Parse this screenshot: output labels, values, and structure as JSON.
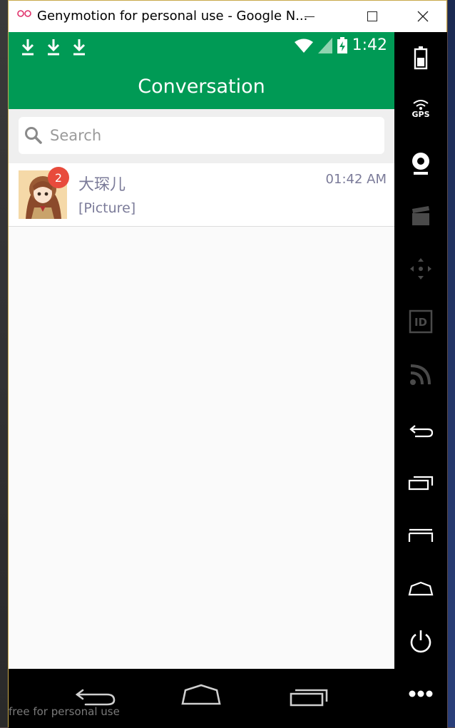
{
  "window": {
    "title": "Genymotion for personal use - Google N..."
  },
  "statusbar": {
    "time": "1:42",
    "download_count": 3
  },
  "appbar": {
    "title": "Conversation"
  },
  "search": {
    "placeholder": "Search"
  },
  "conversations": [
    {
      "name": "大琛儿",
      "time": "01:42 AM",
      "preview": "[Picture]",
      "unread": "2"
    }
  ],
  "watermark": "free for personal use",
  "sidepanel": {
    "gps_label": "GPS",
    "id_label": "ID"
  },
  "colors": {
    "brand_green": "#009a55",
    "badge_red": "#e84b3c",
    "secondary_text": "#7b7b99"
  }
}
